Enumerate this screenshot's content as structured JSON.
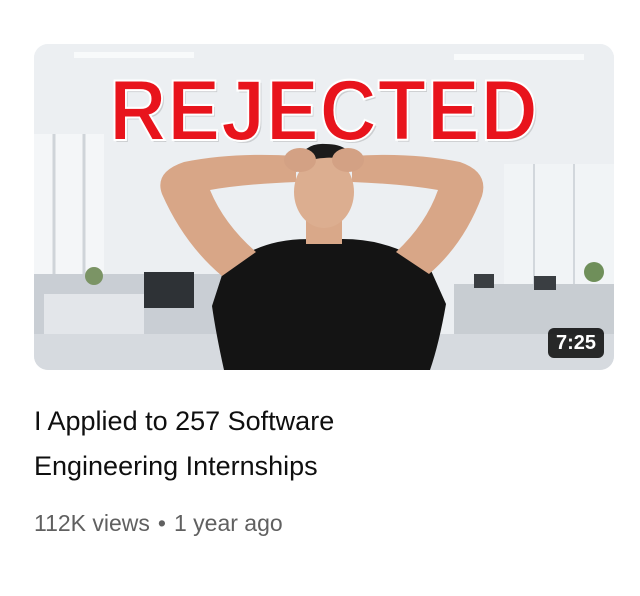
{
  "video": {
    "thumbnail": {
      "headline": "REJECTED",
      "duration": "7:25",
      "headline_color": "#e8141c"
    },
    "title_line1": "I Applied to 257 Software",
    "title_line2": "Engineering Internships",
    "views": "112K views",
    "separator": "•",
    "age": "1 year ago"
  }
}
